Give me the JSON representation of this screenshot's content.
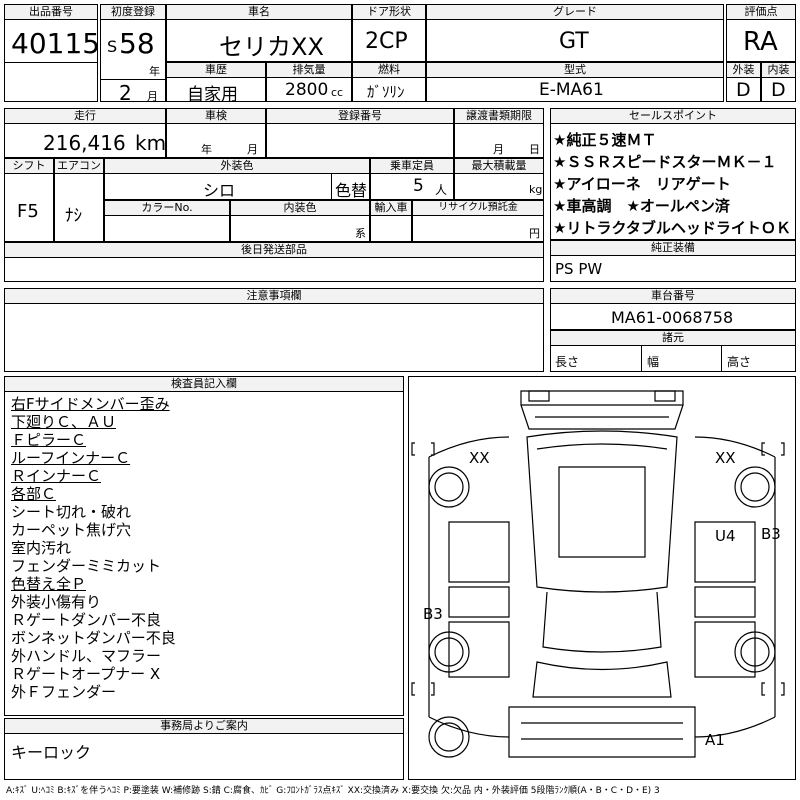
{
  "header": {
    "lot_label": "出品番号",
    "lot_value": "40115",
    "reg_label": "初度登録",
    "era": "S",
    "year": "58",
    "year_unit": "年",
    "month": "2",
    "month_unit": "月",
    "car_name_label": "車名",
    "car_name_value": "セリカXX",
    "door_label": "ドア形状",
    "door_value": "2CP",
    "grade_label": "グレード",
    "grade_value": "GT",
    "rating_label": "評価点",
    "rating_value": "RA",
    "history_label": "車歴",
    "history_value": "自家用",
    "displacement_label": "排気量",
    "displacement_value": "2800",
    "displacement_unit": "cc",
    "fuel_label": "燃料",
    "fuel_value": "ｶﾞｿﾘﾝ",
    "model_label": "型式",
    "model_value": "E-MA61",
    "exterior_label": "外装",
    "exterior_value": "D",
    "interior_label": "内装",
    "interior_value": "D"
  },
  "row2": {
    "mileage_label": "走行",
    "mileage_value": "216,416",
    "mileage_unit": "km",
    "inspection_label": "車検",
    "inspection_year_unit": "年",
    "inspection_month_unit": "月",
    "plate_label": "登録番号",
    "transfer_label": "譲渡書類期限",
    "transfer_month_unit": "月",
    "transfer_day_unit": "日"
  },
  "row3": {
    "shift_label": "シフト",
    "shift_value": "F5",
    "ac_label": "エアコン",
    "ac_value": "ﾅｼ",
    "color_label": "外装色",
    "color_value": "シロ",
    "recolor_value": "色替",
    "capacity_label": "乗車定員",
    "capacity_value": "5",
    "capacity_unit": "人",
    "load_label": "最大積載量",
    "load_unit": "kg",
    "colorno_label": "カラーNo.",
    "intcolor_label": "内装色",
    "intcolor_unit": "系",
    "import_label": "輸入車",
    "recycle_label": "リサイクル預託金",
    "recycle_unit": "円"
  },
  "later_parts_label": "後日発送部品",
  "notes_label": "注意事項欄",
  "sales_points": {
    "label": "セールスポイント",
    "items": [
      "★純正５速ＭＴ",
      "★ＳＳＲスピードスターＭＫ－１",
      "★アイローネ　リアゲート",
      "★車高調　★オールペン済",
      "★リトラクタブルヘッドライトＯＫ"
    ]
  },
  "standard_equipment": {
    "label": "純正装備",
    "value": "PS PW"
  },
  "chassis": {
    "label": "車台番号",
    "value": "MA61-0068758"
  },
  "dimensions": {
    "label": "諸元",
    "length": "長さ",
    "width": "幅",
    "height": "高さ"
  },
  "inspector": {
    "label": "検査員記入欄",
    "lines": [
      "右Fサイドメンバー歪み",
      "下廻りＣ、ＡＵ",
      "ＦピラーＣ",
      "ルーフインナーＣ",
      "ＲインナーＣ",
      "各部Ｃ",
      "シート切れ・破れ",
      "カーペット焦げ穴",
      "室内汚れ",
      "フェンダーミミカット",
      "色替え全Ｐ",
      "外装小傷有り",
      "Ｒゲートダンパー不良",
      "ボンネットダンパー不良",
      "外ハンドル、マフラー",
      "Ｒゲートオープナー X",
      "外Ｆフェンダー"
    ]
  },
  "office": {
    "label": "事務局よりご案内",
    "value": "キーロック"
  },
  "diagram_marks": {
    "fl": "XX",
    "fr": "XX",
    "u4": "U4",
    "b3_right": "B3",
    "b3_left": "B3",
    "a1": "A1"
  },
  "legend": "A:ｷｽﾞ U:ﾍｺﾐ B:ｷｽﾞを伴うﾍｺﾐ P:要塗装 W:補修跡 S:錆 C:腐食、ｶﾋﾞ G:ﾌﾛﾝﾄｶﾞﾗｽ点ｷｽﾞ XX:交換済み X:要交換 欠:欠品 内・外装評価 5段階ﾗﾝｸ順(A・B・C・D・E) 3"
}
